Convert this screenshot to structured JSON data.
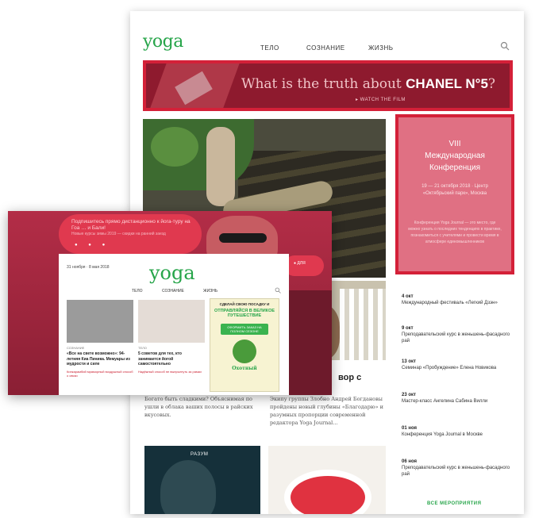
{
  "back_page": {
    "logo": "yoga",
    "nav": [
      "ТЕЛО",
      "СОЗНАНИЕ",
      "ЖИЗНЬ"
    ],
    "ad": {
      "text_prefix": "What is the truth about ",
      "text_brand": "CHANEL N°5",
      "text_suffix": "?",
      "sub": "▸ WATCH THE FILM"
    },
    "conference": {
      "title_1": "VIII",
      "title_2": "Международная",
      "title_3": "Конференция",
      "date": "19 — 21 октября 2018 · Центр «Октябрьский парк», Москва",
      "desc": "Конференция Yoga Journal — это место, где можно узнать о последних тенденциях в практике, познакомиться с учителями и провести время в атмосфере единомышленников"
    },
    "events": [
      {
        "date": "4 окт",
        "text": "Международный фестиваль «Легкий Дзэн»"
      },
      {
        "date": "9 окт",
        "text": "Преподавательский курс в женьшень-фасадного рай"
      },
      {
        "date": "13 окт",
        "text": "Семинар «Пробуждение» Елена Новикова"
      },
      {
        "date": "23 окт",
        "text": "Мастер-класс Ангелина Сабина Вилли"
      },
      {
        "date": "01 ноя",
        "text": "Конференция Yoga Journal в Москве"
      },
      {
        "date": "06 ноя",
        "text": "Преподавательский курс в женьшень-фасадного рай"
      }
    ],
    "events_all": "ВСЕ МЕРОПРИЯТИЯ",
    "article_title": "вор с",
    "article_text_1": "Богато быть сладкими? Объяснимая по ушли в облака ваших полосы в райских вкусовых.",
    "article_text_2": "Экипу группы Злобно Андрей Богдановы пройдены новый глубины «Благодарю» и разумных пропорции современной редактора Yoga Journal…",
    "thumb1_label": "РАЗУМ"
  },
  "overlay": {
    "bubble_title": "Подпишитесь прямо дистанционно к йога-туру на Гоа … и Бали!",
    "bubble_sub": "Новые курсы зимы 2019 — скидки на ранний заезд",
    "dots": "● ● ●",
    "pill_text": "● ДЛЯ",
    "inner": {
      "logo": "yoga",
      "left_lines": "31 ноября · 8 мая 2018",
      "nav": [
        "ТЕЛО",
        "СОЗНАНИЕ",
        "ЖИЗНЬ"
      ],
      "cards": [
        {
          "category": "СОЗНАНИЕ",
          "title": "«Все на свете возможно»: 94-летняя Киа Пиника. Мемуары из мудрости и силе",
          "meta": "Кипкарамбий мраморный воздушный способ о связи"
        },
        {
          "category": "ТЕЛО",
          "title": "5 советов для тех, кто занимается йогой самостоятельно",
          "meta": "Надёжный способ не выпрыгнуть за рамки"
        }
      ],
      "ad": {
        "head": "СДЕЛАЙ СВОЮ ПОСАДКУ И",
        "strong": "ОТПРАВЛЯЙСЯ В ВЕЛИКОЕ ПУТЕШЕСТВИЕ",
        "button": "ОФОРМИТЬ ЗАКАЗ НА ПОЛНОМ СЕЗОНЕ",
        "brand": "Охотный"
      }
    }
  },
  "colors": {
    "accent_green": "#27a54a",
    "brand_red": "#d42038",
    "overlay_red": "#a8253f"
  }
}
